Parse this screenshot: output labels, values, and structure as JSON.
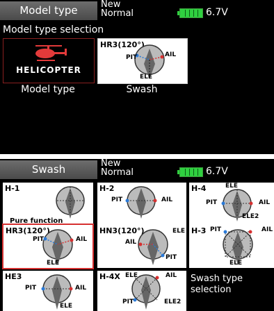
{
  "status": {
    "mode_line1": "New",
    "mode_line2": "Normal",
    "voltage": "6.7V"
  },
  "screen1": {
    "title": "Model type",
    "subtitle": "Model type selection",
    "heli_label": "HELICOPTER",
    "swash_name": "HR3(120°)",
    "caption_left": "Model type",
    "caption_right": "Swash",
    "swash_labels": {
      "pit": "PIT",
      "ail": "AIL",
      "ele": "ELE"
    }
  },
  "screen2": {
    "title": "Swash",
    "info": "Swash type selection",
    "tiles": [
      {
        "name": "H-1",
        "note": "Pure function"
      },
      {
        "name": "H-2",
        "pit": "PIT",
        "ail": "AIL"
      },
      {
        "name": "H-4",
        "ele": "ELE",
        "pit": "PIT",
        "ail": "AIL",
        "ele2": "ELE2"
      },
      {
        "name": "HR3(120°)",
        "pit": "PIT",
        "ail": "AIL",
        "ele": "ELE"
      },
      {
        "name": "HN3(120°)",
        "ele": "ELE",
        "ail": "AIL",
        "pit": "PIT"
      },
      {
        "name": "H-3",
        "pit": "PIT",
        "ail": "AIL",
        "ele": "ELE"
      },
      {
        "name": "HE3",
        "pit": "PIT",
        "ail": "AIL",
        "ele": "ELE"
      },
      {
        "name": "H-4X",
        "ele": "ELE",
        "ail": "AIL",
        "pit": "PIT",
        "ele2": "ELE2"
      }
    ]
  },
  "colors": {
    "accent_red": "#d63030",
    "battery_green": "#2fd040",
    "link_blue": "#2a7ad8"
  }
}
